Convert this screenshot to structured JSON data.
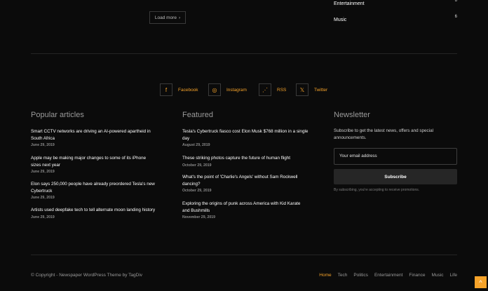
{
  "load_more": {
    "label": "Load more",
    "icon": "chevron-right-icon"
  },
  "categories": [
    {
      "name": "Entertainment",
      "count": "6"
    },
    {
      "name": "Music",
      "count": "6"
    }
  ],
  "social": [
    {
      "icon": "facebook-icon",
      "glyph": "f",
      "label": "Facebook"
    },
    {
      "icon": "instagram-icon",
      "glyph": "◎",
      "label": "Instagram"
    },
    {
      "icon": "rss-icon",
      "glyph": "⋰",
      "label": "RSS"
    },
    {
      "icon": "x-twitter-icon",
      "glyph": "𝕏",
      "label": "Twitter"
    }
  ],
  "popular": {
    "title": "Popular articles",
    "items": [
      {
        "title": "Smart CCTV networks are driving an AI-powered apartheid in South Africa",
        "date": "June 29, 2019"
      },
      {
        "title": "Apple may be making major changes to some of its iPhone sizes next year",
        "date": "June 29, 2019"
      },
      {
        "title": "Elon says 250,000 people have already preordered Tesla's new Cybertruck",
        "date": "June 29, 2019"
      },
      {
        "title": "Artists used deepfake tech to tell alternate moon landing history",
        "date": "June 29, 2019"
      }
    ]
  },
  "featured": {
    "title": "Featured",
    "items": [
      {
        "title": "Tesla's Cybertruck fiasco cost Elon Musk $768 million in a single day",
        "date": "August 29, 2019"
      },
      {
        "title": "These striking photos capture the future of human flight",
        "date": "October 29, 2019"
      },
      {
        "title": "What's the point of 'Charlie's Angels' without Sam Rockwell dancing?",
        "date": "October 29, 2019"
      },
      {
        "title": "Exploring the origins of punk across America with Kid Karate and Bushmills",
        "date": "November 29, 2019"
      }
    ]
  },
  "newsletter": {
    "title": "Newsletter",
    "text": "Subscribe to get the latest news, offers and special announcements.",
    "placeholder": "Your email address",
    "button": "Subscribe",
    "fine_print": "By subscribing, you're accepting to receive promotions."
  },
  "footer": {
    "copyright": "© Copyright - Newspaper WordPress Theme by TagDiv",
    "menu": [
      "Home",
      "Tech",
      "Politics",
      "Entertainment",
      "Finance",
      "Music",
      "Life"
    ],
    "active": "Home"
  },
  "back_to_top": {
    "icon": "arrow-up-icon",
    "glyph": "^"
  },
  "colors": {
    "accent": "#f6a32a",
    "background": "#0b0b0b"
  }
}
